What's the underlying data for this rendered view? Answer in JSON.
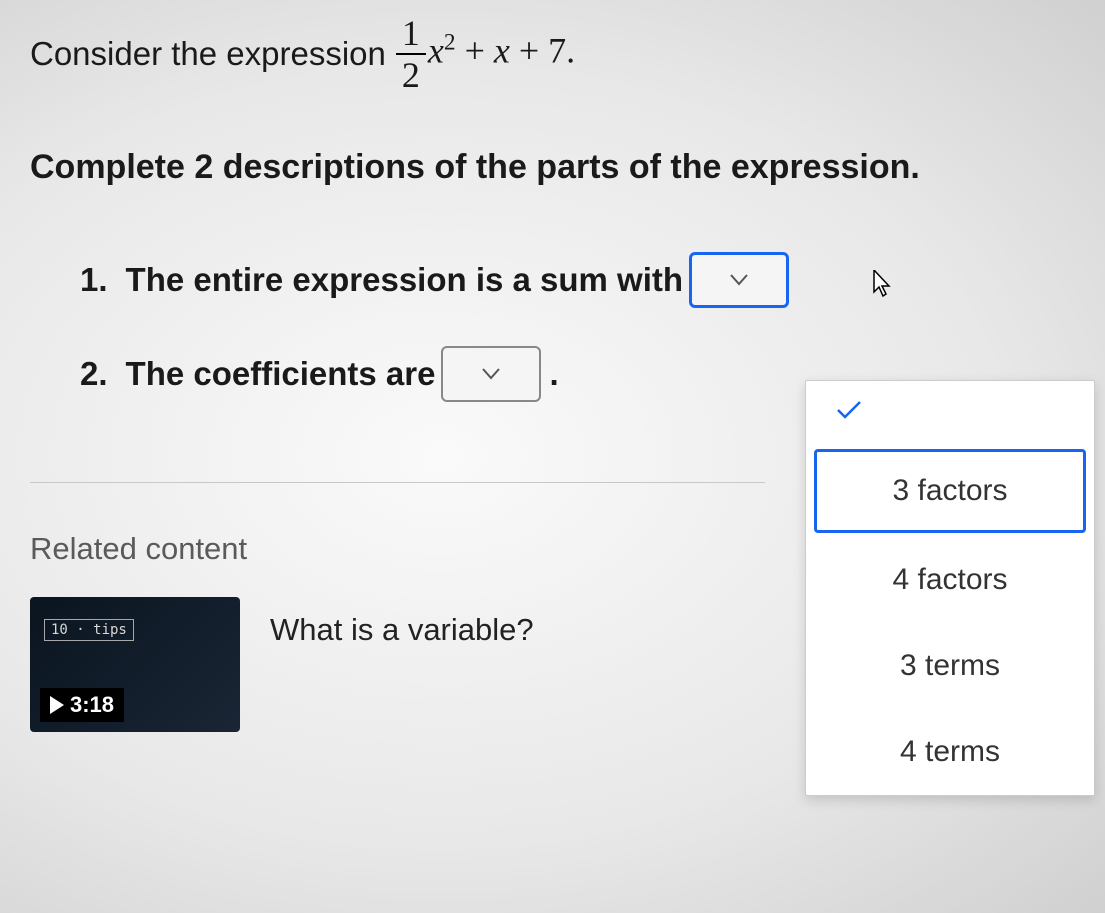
{
  "prompt": {
    "prefix": "Consider the expression",
    "fraction_num": "1",
    "fraction_den": "2",
    "x_var": "x",
    "exponent": "2",
    "plus1": "+",
    "plus2": "+",
    "const": "7",
    "period": "."
  },
  "instruction": "Complete 2 descriptions of the parts of the expression.",
  "questions": {
    "q1": {
      "num": "1.",
      "text": "The entire expression is a sum with",
      "period": "."
    },
    "q2": {
      "num": "2.",
      "text": "The coefficients are",
      "period": "."
    }
  },
  "dropdown": {
    "options": [
      "3 factors",
      "4 factors",
      "3 terms",
      "4 terms"
    ]
  },
  "related": {
    "heading": "Related content",
    "video": {
      "title": "What is a variable?",
      "duration": "3:18",
      "thumb_text": "10 · tips"
    }
  }
}
